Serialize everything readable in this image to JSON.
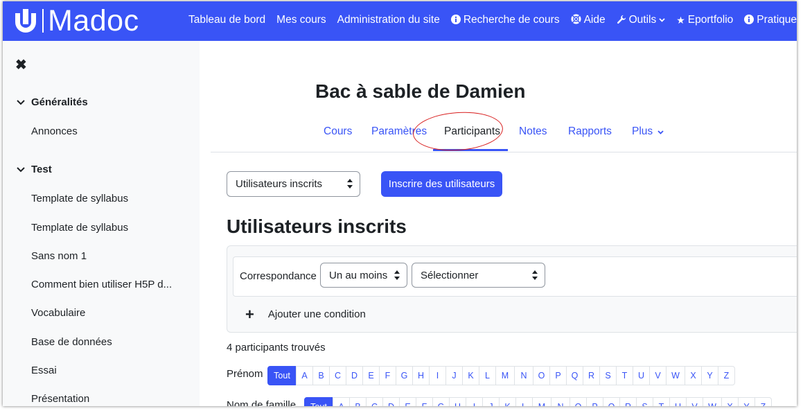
{
  "brand": {
    "name": "Madoc"
  },
  "nav": [
    {
      "label": "Tableau de bord",
      "icon": ""
    },
    {
      "label": "Mes cours",
      "icon": ""
    },
    {
      "label": "Administration du site",
      "icon": ""
    },
    {
      "label": "Recherche de cours",
      "icon": "info-circle-icon"
    },
    {
      "label": "Aide",
      "icon": "lifebuoy-icon"
    },
    {
      "label": "Outils",
      "icon": "wrench-icon",
      "dropdown": true
    },
    {
      "label": "Eportfolio",
      "icon": "star-icon"
    },
    {
      "label": "Pratiques péd",
      "icon": "info-circle-icon"
    }
  ],
  "sidebar": {
    "close_glyph": "✖",
    "sections": [
      {
        "label": "Généralités",
        "items": [
          "Annonces"
        ]
      },
      {
        "label": "Test",
        "items": [
          "Template de syllabus",
          "Template de syllabus",
          "Sans nom 1",
          "Comment bien utiliser H5P d...",
          "Vocabulaire",
          "Base de données",
          "Essai",
          "Présentation"
        ]
      }
    ]
  },
  "course": {
    "title": "Bac à sable de Damien",
    "tabs": [
      {
        "label": "Cours",
        "active": false
      },
      {
        "label": "Paramètres",
        "active": false
      },
      {
        "label": "Participants",
        "active": true
      },
      {
        "label": "Notes",
        "active": false
      },
      {
        "label": "Rapports",
        "active": false
      },
      {
        "label": "Plus",
        "active": false,
        "dropdown": true
      }
    ]
  },
  "participants": {
    "view_select": "Utilisateurs inscrits",
    "enrol_button": "Inscrire des utilisateurs",
    "heading": "Utilisateurs inscrits",
    "filter": {
      "match_label": "Correspondance",
      "match_value": "Un au moins",
      "type_value": "Sélectionner",
      "add_condition": "Ajouter une condition"
    },
    "found": "4 participants trouvés",
    "firstname_label": "Prénom",
    "lastname_label": "Nom de famille",
    "initials": [
      "Tout",
      "A",
      "B",
      "C",
      "D",
      "E",
      "F",
      "G",
      "H",
      "I",
      "J",
      "K",
      "L",
      "M",
      "N",
      "O",
      "P",
      "Q",
      "R",
      "S",
      "T",
      "U",
      "V",
      "W",
      "X",
      "Y",
      "Z"
    ]
  },
  "colors": {
    "accent": "#3954f6",
    "annotation": "#d81e1e"
  }
}
